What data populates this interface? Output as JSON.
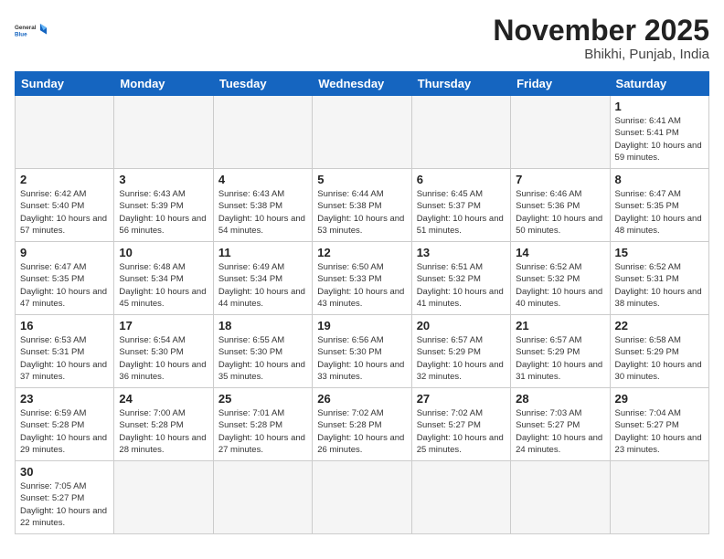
{
  "header": {
    "logo_general": "General",
    "logo_blue": "Blue",
    "month_title": "November 2025",
    "location": "Bhikhi, Punjab, India"
  },
  "weekdays": [
    "Sunday",
    "Monday",
    "Tuesday",
    "Wednesday",
    "Thursday",
    "Friday",
    "Saturday"
  ],
  "days": {
    "d1": {
      "num": "1",
      "sunrise": "6:41 AM",
      "sunset": "5:41 PM",
      "daylight": "10 hours and 59 minutes."
    },
    "d2": {
      "num": "2",
      "sunrise": "6:42 AM",
      "sunset": "5:40 PM",
      "daylight": "10 hours and 57 minutes."
    },
    "d3": {
      "num": "3",
      "sunrise": "6:43 AM",
      "sunset": "5:39 PM",
      "daylight": "10 hours and 56 minutes."
    },
    "d4": {
      "num": "4",
      "sunrise": "6:43 AM",
      "sunset": "5:38 PM",
      "daylight": "10 hours and 54 minutes."
    },
    "d5": {
      "num": "5",
      "sunrise": "6:44 AM",
      "sunset": "5:38 PM",
      "daylight": "10 hours and 53 minutes."
    },
    "d6": {
      "num": "6",
      "sunrise": "6:45 AM",
      "sunset": "5:37 PM",
      "daylight": "10 hours and 51 minutes."
    },
    "d7": {
      "num": "7",
      "sunrise": "6:46 AM",
      "sunset": "5:36 PM",
      "daylight": "10 hours and 50 minutes."
    },
    "d8": {
      "num": "8",
      "sunrise": "6:47 AM",
      "sunset": "5:35 PM",
      "daylight": "10 hours and 48 minutes."
    },
    "d9": {
      "num": "9",
      "sunrise": "6:47 AM",
      "sunset": "5:35 PM",
      "daylight": "10 hours and 47 minutes."
    },
    "d10": {
      "num": "10",
      "sunrise": "6:48 AM",
      "sunset": "5:34 PM",
      "daylight": "10 hours and 45 minutes."
    },
    "d11": {
      "num": "11",
      "sunrise": "6:49 AM",
      "sunset": "5:34 PM",
      "daylight": "10 hours and 44 minutes."
    },
    "d12": {
      "num": "12",
      "sunrise": "6:50 AM",
      "sunset": "5:33 PM",
      "daylight": "10 hours and 43 minutes."
    },
    "d13": {
      "num": "13",
      "sunrise": "6:51 AM",
      "sunset": "5:32 PM",
      "daylight": "10 hours and 41 minutes."
    },
    "d14": {
      "num": "14",
      "sunrise": "6:52 AM",
      "sunset": "5:32 PM",
      "daylight": "10 hours and 40 minutes."
    },
    "d15": {
      "num": "15",
      "sunrise": "6:52 AM",
      "sunset": "5:31 PM",
      "daylight": "10 hours and 38 minutes."
    },
    "d16": {
      "num": "16",
      "sunrise": "6:53 AM",
      "sunset": "5:31 PM",
      "daylight": "10 hours and 37 minutes."
    },
    "d17": {
      "num": "17",
      "sunrise": "6:54 AM",
      "sunset": "5:30 PM",
      "daylight": "10 hours and 36 minutes."
    },
    "d18": {
      "num": "18",
      "sunrise": "6:55 AM",
      "sunset": "5:30 PM",
      "daylight": "10 hours and 35 minutes."
    },
    "d19": {
      "num": "19",
      "sunrise": "6:56 AM",
      "sunset": "5:30 PM",
      "daylight": "10 hours and 33 minutes."
    },
    "d20": {
      "num": "20",
      "sunrise": "6:57 AM",
      "sunset": "5:29 PM",
      "daylight": "10 hours and 32 minutes."
    },
    "d21": {
      "num": "21",
      "sunrise": "6:57 AM",
      "sunset": "5:29 PM",
      "daylight": "10 hours and 31 minutes."
    },
    "d22": {
      "num": "22",
      "sunrise": "6:58 AM",
      "sunset": "5:29 PM",
      "daylight": "10 hours and 30 minutes."
    },
    "d23": {
      "num": "23",
      "sunrise": "6:59 AM",
      "sunset": "5:28 PM",
      "daylight": "10 hours and 29 minutes."
    },
    "d24": {
      "num": "24",
      "sunrise": "7:00 AM",
      "sunset": "5:28 PM",
      "daylight": "10 hours and 28 minutes."
    },
    "d25": {
      "num": "25",
      "sunrise": "7:01 AM",
      "sunset": "5:28 PM",
      "daylight": "10 hours and 27 minutes."
    },
    "d26": {
      "num": "26",
      "sunrise": "7:02 AM",
      "sunset": "5:28 PM",
      "daylight": "10 hours and 26 minutes."
    },
    "d27": {
      "num": "27",
      "sunrise": "7:02 AM",
      "sunset": "5:27 PM",
      "daylight": "10 hours and 25 minutes."
    },
    "d28": {
      "num": "28",
      "sunrise": "7:03 AM",
      "sunset": "5:27 PM",
      "daylight": "10 hours and 24 minutes."
    },
    "d29": {
      "num": "29",
      "sunrise": "7:04 AM",
      "sunset": "5:27 PM",
      "daylight": "10 hours and 23 minutes."
    },
    "d30": {
      "num": "30",
      "sunrise": "7:05 AM",
      "sunset": "5:27 PM",
      "daylight": "10 hours and 22 minutes."
    }
  },
  "labels": {
    "sunrise": "Sunrise:",
    "sunset": "Sunset:",
    "daylight": "Daylight:"
  }
}
